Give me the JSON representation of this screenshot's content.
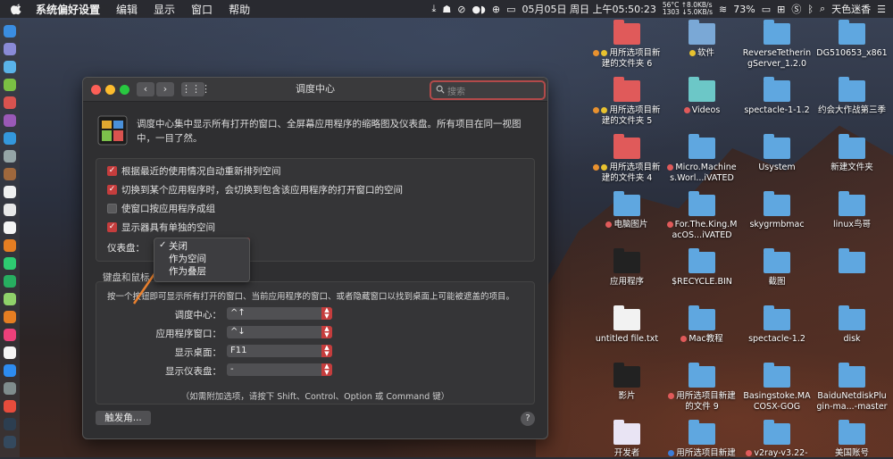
{
  "menubar": {
    "app_name": "系统偏好设置",
    "menus": [
      "编辑",
      "显示",
      "窗口",
      "帮助"
    ],
    "net_up": "56°C ↑8.0KB/s",
    "net_down": "1303 ↓5.0KB/s",
    "datetime": "05月05日 周日 上午05:50:23",
    "battery": "73%",
    "user": "天色迷香"
  },
  "window": {
    "title": "调度中心",
    "search_placeholder": "搜索",
    "intro": "调度中心集中显示所有打开的窗口、全屏幕应用程序的缩略图及仪表盘。所有项目在同一视图中，一目了然。",
    "checkboxes": [
      {
        "label": "根据最近的使用情况自动重新排列空间",
        "checked": true
      },
      {
        "label": "切换到某个应用程序时，会切换到包含该应用程序的打开窗口的空间",
        "checked": true
      },
      {
        "label": "使窗口按应用程序成组",
        "checked": false
      },
      {
        "label": "显示器具有单独的空间",
        "checked": true
      }
    ],
    "dashboard_label": "仪表盘：",
    "dashboard_options": [
      "关闭",
      "作为空间",
      "作为叠层"
    ],
    "dashboard_selected": "关闭",
    "shortcut_heading": "键盘和鼠标",
    "shortcut_desc": "按一个按钮即可显示所有打开的窗口、当前应用程序的窗口、或者隐藏窗口以找到桌面上可能被遮盖的项目。",
    "shortcuts": [
      {
        "label": "调度中心：",
        "value": "^↑"
      },
      {
        "label": "应用程序窗口：",
        "value": "^↓"
      },
      {
        "label": "显示桌面：",
        "value": "F11"
      },
      {
        "label": "显示仪表盘：",
        "value": "-"
      }
    ],
    "shortcut_note": "（如需附加选项，请按下 Shift、Control、Option 或 Command 键）",
    "hot_corners": "触发角...",
    "help": "?"
  },
  "desktop": [
    {
      "label": "用所选项目新建的文件夹 6",
      "color": "#e05a5a",
      "tags": [
        "#e8912f",
        "#e8c22f"
      ]
    },
    {
      "label": "软件",
      "color": "#7aa8d6",
      "tags": [
        "#e8c22f"
      ]
    },
    {
      "label": "ReverseTetheringServer_1.2.0",
      "color": "#5fa7e0",
      "tags": []
    },
    {
      "label": "DG510653_x861",
      "color": "#5fa7e0",
      "tags": []
    },
    {
      "label": "用所选项目新建的文件夹 5",
      "color": "#e05a5a",
      "tags": [
        "#e8912f",
        "#e8c22f"
      ]
    },
    {
      "label": "Videos",
      "color": "#6cc7c7",
      "tags": [
        "#e05a5a"
      ]
    },
    {
      "label": "spectacle-1-1.2",
      "color": "#5fa7e0",
      "tags": []
    },
    {
      "label": "约会大作战第三季",
      "color": "#5fa7e0",
      "tags": []
    },
    {
      "label": "用所选项目新建的文件夹 4",
      "color": "#e05a5a",
      "tags": [
        "#e8912f",
        "#e8c22f"
      ]
    },
    {
      "label": "Micro.Machines.Worl...iVATED",
      "color": "#5fa7e0",
      "tags": [
        "#e05a5a"
      ]
    },
    {
      "label": "Usystem",
      "color": "#5fa7e0",
      "tags": []
    },
    {
      "label": "新建文件夹",
      "color": "#5fa7e0",
      "tags": []
    },
    {
      "label": "电脑图片",
      "color": "#5fa7e0",
      "tags": [
        "#e05a5a"
      ]
    },
    {
      "label": "For.The.King.MacOS...iVATED",
      "color": "#5fa7e0",
      "tags": [
        "#e05a5a"
      ]
    },
    {
      "label": "skygrmbmac",
      "color": "#5fa7e0",
      "tags": []
    },
    {
      "label": "linux鸟哥",
      "color": "#5fa7e0",
      "tags": []
    },
    {
      "label": "应用程序",
      "color": "#222222",
      "tags": []
    },
    {
      "label": "$RECYCLE.BIN",
      "color": "#5fa7e0",
      "tags": []
    },
    {
      "label": "截图",
      "color": "#5fa7e0",
      "tags": []
    },
    {
      "label": "",
      "color": "#5fa7e0",
      "tags": []
    },
    {
      "label": "untitled file.txt",
      "color": "#f2f2f2",
      "tags": []
    },
    {
      "label": "Mac教程",
      "color": "#5fa7e0",
      "tags": [
        "#e05a5a"
      ]
    },
    {
      "label": "spectacle-1.2",
      "color": "#5fa7e0",
      "tags": []
    },
    {
      "label": "disk",
      "color": "#5fa7e0",
      "tags": []
    },
    {
      "label": "影片",
      "color": "#222222",
      "tags": []
    },
    {
      "label": "用所选项目新建的文件 9",
      "color": "#5fa7e0",
      "tags": [
        "#e05a5a"
      ]
    },
    {
      "label": "Basingstoke.MACOSX-GOG",
      "color": "#5fa7e0",
      "tags": []
    },
    {
      "label": "BaiduNetdiskPlugin-ma...-master",
      "color": "#5fa7e0",
      "tags": []
    },
    {
      "label": "开发者",
      "color": "#e9e4f4",
      "tags": []
    },
    {
      "label": "用所选项目新建",
      "color": "#5fa7e0",
      "tags": [
        "#3c7dd9"
      ]
    },
    {
      "label": "v2ray-v3.22-",
      "color": "#5fa7e0",
      "tags": [
        "#e05a5a"
      ]
    },
    {
      "label": "美国账号",
      "color": "#5fa7e0",
      "tags": []
    }
  ]
}
